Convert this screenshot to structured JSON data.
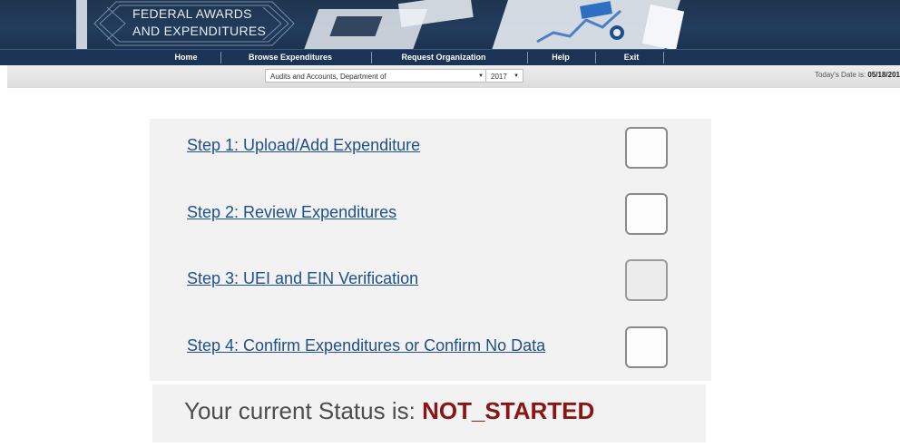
{
  "header": {
    "logo_line1": "FEDERAL AWARDS",
    "logo_line2": "AND EXPENDITURES"
  },
  "nav": {
    "items": [
      "Home",
      "Browse Expenditures",
      "Request Organization",
      "Help",
      "Exit"
    ]
  },
  "selectors": {
    "department": "Audits and Accounts, Department of",
    "year": "2017",
    "today_label": "Today's Date is:",
    "today_value": "05/18/201"
  },
  "steps": [
    {
      "label": "Step 1: Upload/Add Expenditure",
      "checked": false
    },
    {
      "label": "Step 2: Review Expenditures",
      "checked": false
    },
    {
      "label": "Step 3: UEI and EIN Verification",
      "checked": false
    },
    {
      "label": "Step 4: Confirm Expenditures or Confirm No Data",
      "checked": false
    }
  ],
  "status": {
    "prefix": "Your current Status is:",
    "value": "NOT_STARTED",
    "value_color": "#8b1414"
  },
  "colors": {
    "banner": "#1f3550",
    "nav": "#1b3456",
    "link": "#1f4f8c"
  }
}
